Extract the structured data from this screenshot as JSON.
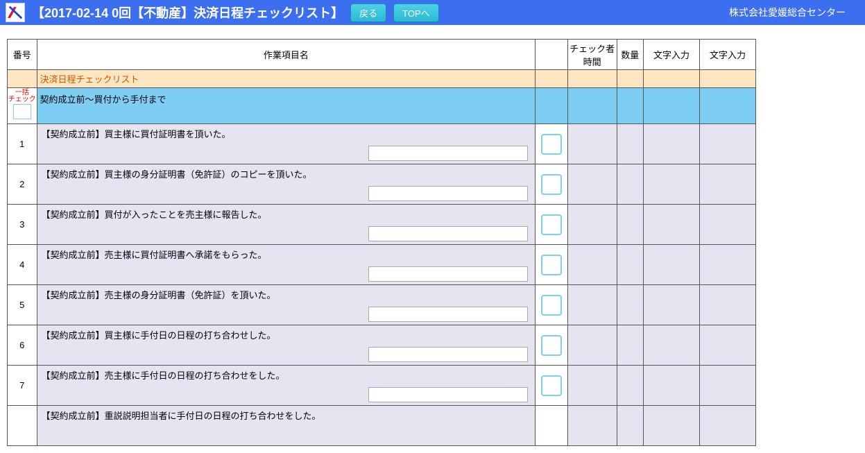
{
  "header": {
    "title": "【2017-02-14 0回【不動産】決済日程チェックリスト】",
    "back_label": "戻る",
    "top_label": "TOPへ",
    "company": "株式会社愛媛総合センター"
  },
  "columns": {
    "num": "番号",
    "item": "作業項目名",
    "check": "",
    "checker": "チェック者\n時間",
    "qty": "数量",
    "text1": "文字入力",
    "text2": "文字入力"
  },
  "group_title": "決済日程チェックリスト",
  "bulk_check_label1": "一括",
  "bulk_check_label2": "チェック",
  "section_title": "契約成立前～買付から手付まで",
  "tasks": [
    {
      "num": "1",
      "text": "【契約成立前】買主様に買付証明書を頂いた。",
      "input": ""
    },
    {
      "num": "2",
      "text": "【契約成立前】買主様の身分証明書（免許証）のコピーを頂いた。",
      "input": ""
    },
    {
      "num": "3",
      "text": "【契約成立前】買付が入ったことを売主様に報告した。",
      "input": ""
    },
    {
      "num": "4",
      "text": "【契約成立前】売主様に買付証明書へ承諾をもらった。",
      "input": ""
    },
    {
      "num": "5",
      "text": "【契約成立前】売主様の身分証明書（免許証）を頂いた。",
      "input": ""
    },
    {
      "num": "6",
      "text": "【契約成立前】買主様に手付日の日程の打ち合わせした。",
      "input": ""
    },
    {
      "num": "7",
      "text": "【契約成立前】売主様に手付日の日程の打ち合わせをした。",
      "input": ""
    }
  ],
  "partial_task": {
    "text": "【契約成立前】重説説明担当者に手付日の日程の打ち合わせをした。"
  }
}
